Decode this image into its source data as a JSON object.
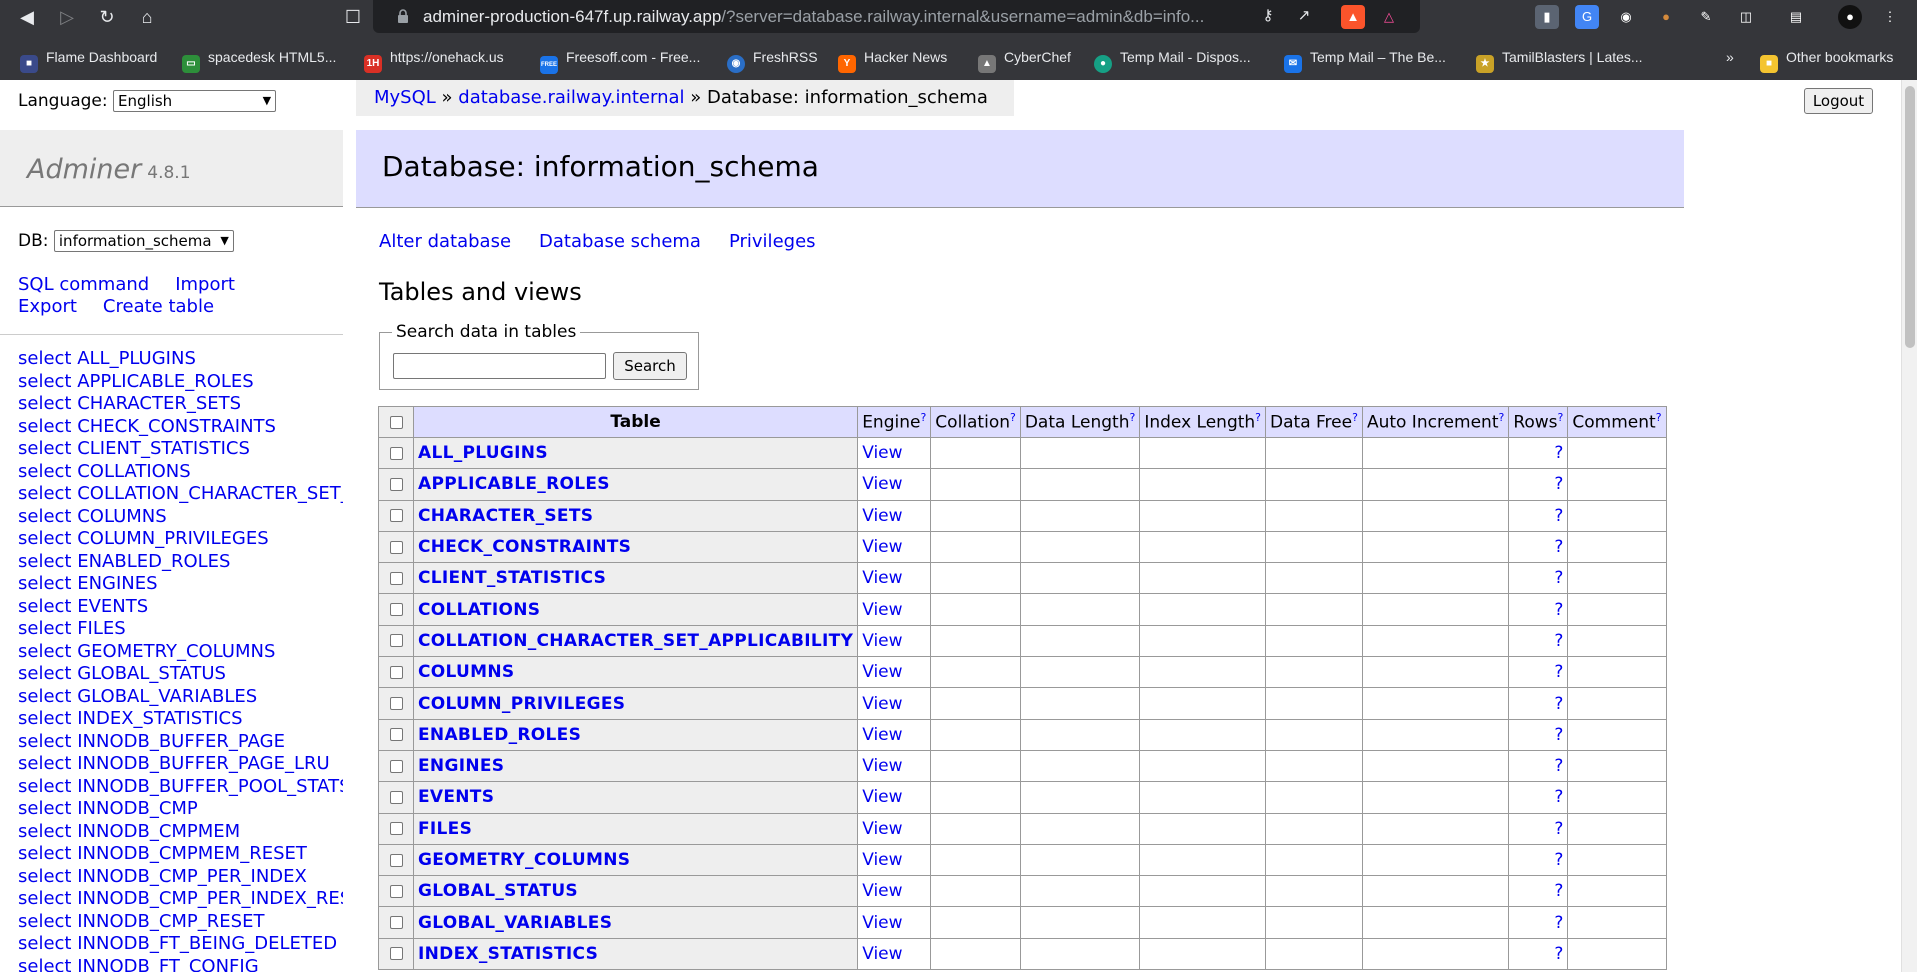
{
  "browser": {
    "url_host": "adminer-production-647f.up.railway.app",
    "url_rest": "/?server=database.railway.internal&username=admin&db=info...",
    "bookmarks": [
      {
        "label": "Flame Dashboard"
      },
      {
        "label": "spacedesk HTML5..."
      },
      {
        "label": "https://onehack.us"
      },
      {
        "label": "Freesoff.com - Free..."
      },
      {
        "label": "FreshRSS"
      },
      {
        "label": "Hacker News"
      },
      {
        "label": "CyberChef"
      },
      {
        "label": "Temp Mail - Dispos..."
      },
      {
        "label": "Temp Mail – The Be..."
      },
      {
        "label": "TamilBlasters | Lates..."
      }
    ],
    "more_bookmarks": "»",
    "other_bookmarks": "Other bookmarks",
    "fav_onehack": "1H",
    "fav_freesoff": "FREE",
    "fav_hn": "Y"
  },
  "page": {
    "language_label": "Language:",
    "language_value": "English",
    "logout_label": "Logout",
    "app_name": "Adminer",
    "app_version": "4.8.1",
    "db_label": "DB:",
    "db_value": "information_schema",
    "menu_links": {
      "sql_command": "SQL command",
      "import": "Import",
      "export": "Export",
      "create_table": "Create table"
    },
    "breadcrumb": {
      "driver": "MySQL",
      "sep": " » ",
      "server": "database.railway.internal",
      "current": "Database: information_schema"
    },
    "heading": "Database: information_schema",
    "actions": {
      "alter": "Alter database",
      "schema": "Database schema",
      "privileges": "Privileges"
    },
    "tables_heading": "Tables and views",
    "search": {
      "legend": "Search data in tables",
      "value": "",
      "button": "Search"
    },
    "table_headers": {
      "table": "Table",
      "engine": "Engine",
      "collation": "Collation",
      "data_length": "Data Length",
      "index_length": "Index Length",
      "data_free": "Data Free",
      "auto_increment": "Auto Increment",
      "rows": "Rows",
      "comment": "Comment",
      "help": "?"
    },
    "view_label": "View",
    "rows_value": "?",
    "sidebar_tables": [
      "select ALL_PLUGINS",
      "select APPLICABLE_ROLES",
      "select CHARACTER_SETS",
      "select CHECK_CONSTRAINTS",
      "select CLIENT_STATISTICS",
      "select COLLATIONS",
      "select COLLATION_CHARACTER_SET_APPLICABILITY",
      "select COLUMNS",
      "select COLUMN_PRIVILEGES",
      "select ENABLED_ROLES",
      "select ENGINES",
      "select EVENTS",
      "select FILES",
      "select GEOMETRY_COLUMNS",
      "select GLOBAL_STATUS",
      "select GLOBAL_VARIABLES",
      "select INDEX_STATISTICS",
      "select INNODB_BUFFER_PAGE",
      "select INNODB_BUFFER_PAGE_LRU",
      "select INNODB_BUFFER_POOL_STATS",
      "select INNODB_CMP",
      "select INNODB_CMPMEM",
      "select INNODB_CMPMEM_RESET",
      "select INNODB_CMP_PER_INDEX",
      "select INNODB_CMP_PER_INDEX_RESET",
      "select INNODB_CMP_RESET",
      "select INNODB_FT_BEING_DELETED",
      "select INNODB_FT_CONFIG"
    ],
    "tables": [
      "ALL_PLUGINS",
      "APPLICABLE_ROLES",
      "CHARACTER_SETS",
      "CHECK_CONSTRAINTS",
      "CLIENT_STATISTICS",
      "COLLATIONS",
      "COLLATION_CHARACTER_SET_APPLICABILITY",
      "COLUMNS",
      "COLUMN_PRIVILEGES",
      "ENABLED_ROLES",
      "ENGINES",
      "EVENTS",
      "FILES",
      "GEOMETRY_COLUMNS",
      "GLOBAL_STATUS",
      "GLOBAL_VARIABLES",
      "INDEX_STATISTICS"
    ]
  },
  "colors": {
    "link": "#0000ee",
    "header_bg": "#ddf",
    "chrome_bg": "#35363a"
  }
}
